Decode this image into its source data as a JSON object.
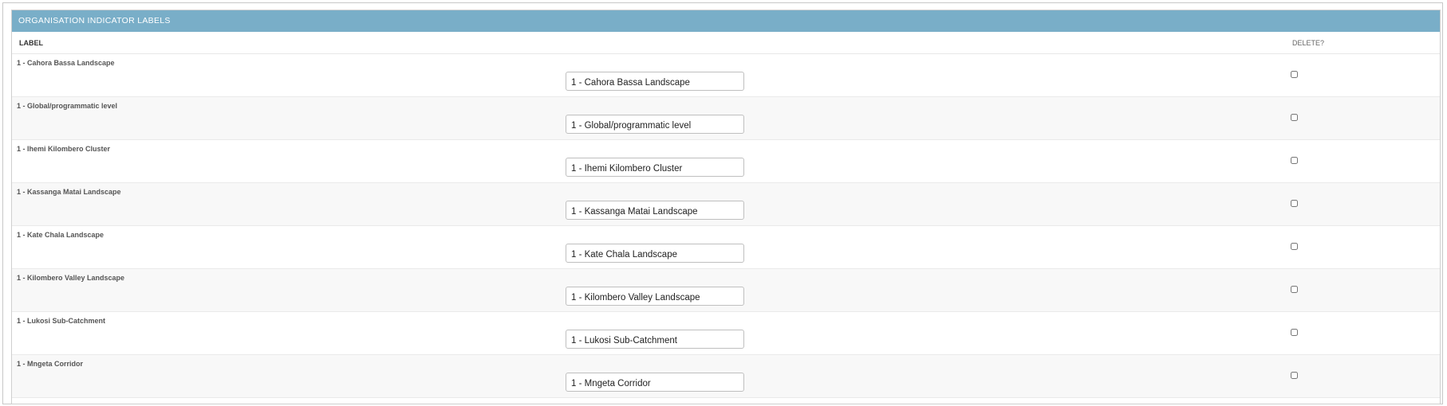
{
  "module": {
    "title": "ORGANISATION INDICATOR LABELS"
  },
  "columns": {
    "label": "LABEL",
    "delete": "DELETE?"
  },
  "rows": [
    {
      "label": "1 - Cahora Bassa Landscape",
      "value": "1 - Cahora Bassa Landscape",
      "delete": false
    },
    {
      "label": "1 - Global/programmatic level",
      "value": "1 - Global/programmatic level",
      "delete": false
    },
    {
      "label": "1 - Ihemi Kilombero Cluster",
      "value": "1 - Ihemi Kilombero Cluster",
      "delete": false
    },
    {
      "label": "1 - Kassanga Matai Landscape",
      "value": "1 - Kassanga Matai Landscape",
      "delete": false
    },
    {
      "label": "1 - Kate Chala Landscape",
      "value": "1 - Kate Chala Landscape",
      "delete": false
    },
    {
      "label": "1 - Kilombero Valley Landscape",
      "value": "1 - Kilombero Valley Landscape",
      "delete": false
    },
    {
      "label": "1 - Lukosi Sub-Catchment",
      "value": "1 - Lukosi Sub-Catchment",
      "delete": false
    },
    {
      "label": "1 - Mngeta Corridor",
      "value": "1 - Mngeta Corridor",
      "delete": false
    }
  ],
  "colors": {
    "header_bg": "#79aec8",
    "header_text": "#ffffff",
    "row_alt_bg": "#f8f8f8"
  }
}
